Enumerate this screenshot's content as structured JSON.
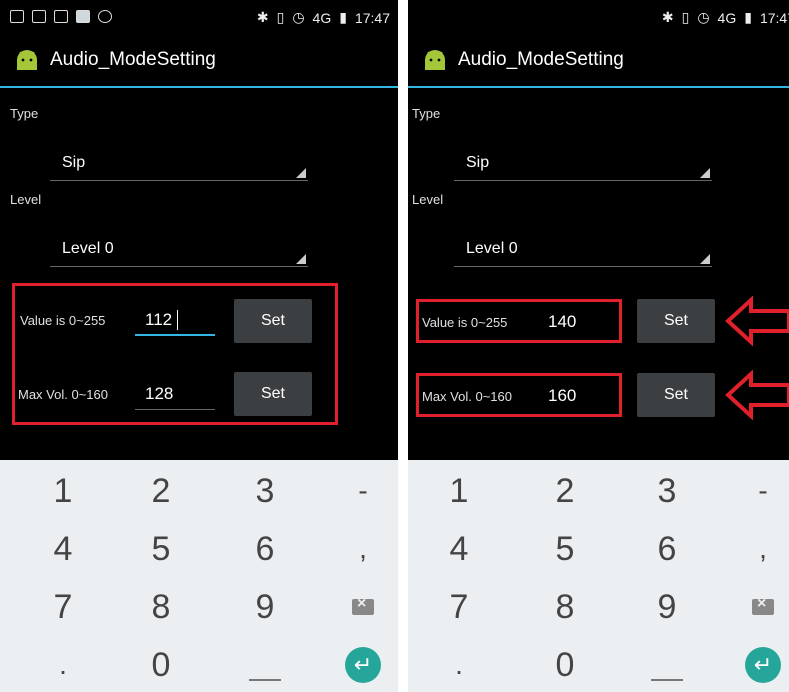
{
  "statusbar": {
    "bt": "✱",
    "wifi": "4G",
    "time": "17:47"
  },
  "app": {
    "title": "Audio_ModeSetting"
  },
  "labels": {
    "type": "Type",
    "level": "Level"
  },
  "screens": {
    "left": {
      "type_value": "Sip",
      "level_value": "Level 0",
      "value_label": "Value is 0~255",
      "value_input": "112",
      "maxvol_label": "Max Vol. 0~160",
      "maxvol_input": "128",
      "set_label": "Set"
    },
    "right": {
      "type_value": "Sip",
      "level_value": "Level 0",
      "value_label": "Value is 0~255",
      "value_input": "140",
      "maxvol_label": "Max Vol. 0~160",
      "maxvol_input": "160",
      "set_label": "Set"
    }
  },
  "keypad": {
    "keys": [
      "1",
      "2",
      "3",
      "-",
      "4",
      "5",
      "6",
      ",",
      "7",
      "8",
      "9",
      ".",
      "0"
    ],
    "delete_icon": "backspace-icon",
    "enter_icon": "enter-icon"
  },
  "colors": {
    "accent": "#33b5e5",
    "highlight": "#e0202a",
    "enter": "#26a69a",
    "android": "#a4c639"
  }
}
